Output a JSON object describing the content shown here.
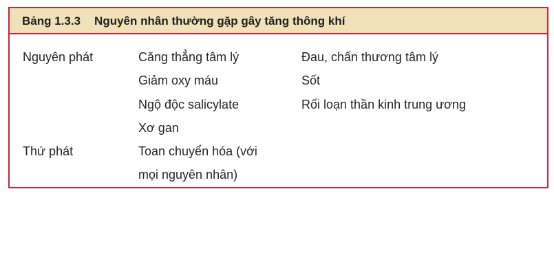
{
  "table": {
    "number": "Bảng 1.3.3",
    "title": "Nguyên nhân thường gặp gây tăng thông khí",
    "rows": [
      {
        "category": "Nguyên phát",
        "col1": [
          "Căng thẳng tâm lý",
          "Giảm oxy máu",
          "Ngộ độc salicylate",
          "Xơ gan"
        ],
        "col2": [
          "Đau, chấn thương tâm lý",
          "Sốt",
          "Rối loạn thần kinh trung ương"
        ]
      },
      {
        "category": "Thứ phát",
        "col1": [
          "Toan chuyển hóa (với",
          "mọi nguyên nhân)"
        ],
        "col2": []
      }
    ]
  },
  "colors": {
    "border": "#c8283a",
    "header_bg": "#f1e1b8"
  }
}
